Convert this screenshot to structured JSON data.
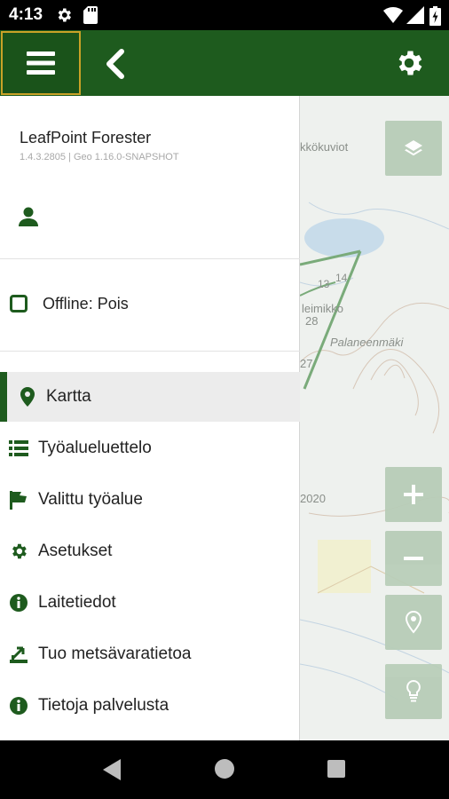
{
  "status_bar": {
    "time": "4:13"
  },
  "drawer": {
    "app_name": "LeafPoint Forester",
    "app_version": "1.4.3.2805 | Geo 1.16.0-SNAPSHOT",
    "offline_label": "Offline: Pois",
    "items": [
      {
        "label": "Kartta",
        "icon": "map-pin-icon",
        "active": true
      },
      {
        "label": "Työalueluettelo",
        "icon": "list-icon",
        "active": false
      },
      {
        "label": "Valittu työalue",
        "icon": "flag-icon",
        "active": false
      },
      {
        "label": "Asetukset",
        "icon": "gear-icon",
        "active": false
      },
      {
        "label": "Laitetiedot",
        "icon": "info-icon",
        "active": false
      },
      {
        "label": "Tuo metsävaratietoa",
        "icon": "import-icon",
        "active": false
      },
      {
        "label": "Tietoja palvelusta",
        "icon": "info-icon",
        "active": false
      }
    ]
  },
  "map": {
    "labels": {
      "top": "kkökuviot",
      "a": "13",
      "b": "14",
      "c": "leimikko",
      "d": "28",
      "e": "Palaneenmäki",
      "f": "27",
      "g": "2020"
    }
  },
  "colors": {
    "primary_green": "#1e5b1e",
    "menu_focus_border": "#c9a227",
    "map_button": "#b8cdb8"
  }
}
